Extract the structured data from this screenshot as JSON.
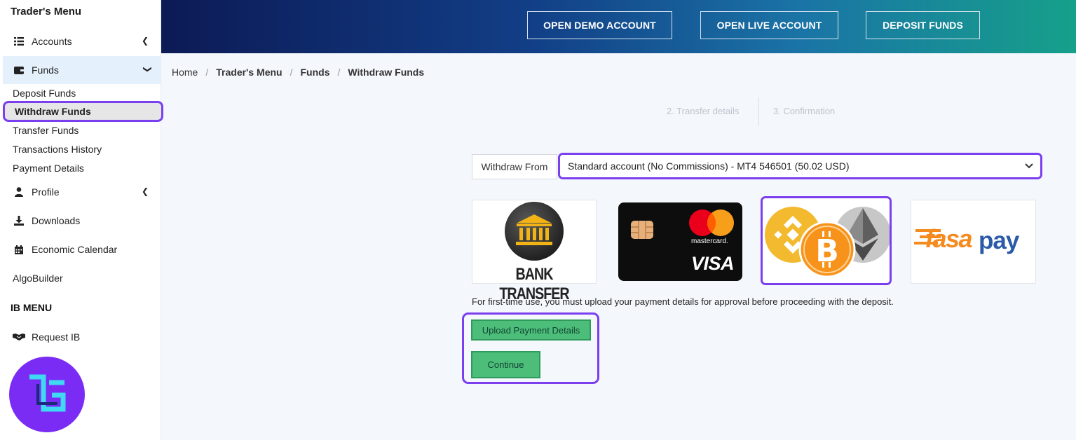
{
  "sidebar": {
    "title": "Trader's Menu",
    "accounts": {
      "label": "Accounts",
      "icon": "list-icon"
    },
    "funds": {
      "label": "Funds",
      "icon": "wallet-icon"
    },
    "funds_sub": [
      "Deposit Funds",
      "Withdraw Funds",
      "Transfer Funds",
      "Transactions History",
      "Payment Details"
    ],
    "profile": {
      "label": "Profile",
      "icon": "user-icon"
    },
    "downloads": {
      "label": "Downloads",
      "icon": "download-icon"
    },
    "calendar": {
      "label": "Economic Calendar",
      "icon": "calendar-icon"
    },
    "algobuilder": "AlgoBuilder",
    "ib_menu": "IB MENU",
    "request_ib": {
      "label": "Request IB",
      "icon": "handshake-icon"
    }
  },
  "header": {
    "open_demo": "OPEN DEMO ACCOUNT",
    "open_live": "OPEN LIVE ACCOUNT",
    "deposit": "DEPOSIT FUNDS"
  },
  "breadcrumb": {
    "home": "Home",
    "traders_menu": "Trader's Menu",
    "funds": "Funds",
    "current": "Withdraw Funds"
  },
  "steps": {
    "step2": "2. Transfer details",
    "step3": "3. Confirmation"
  },
  "withdraw": {
    "label": "Withdraw From",
    "selected_account": "Standard account (No Commissions) - MT4 546501 (50.02 USD)"
  },
  "methods": {
    "bank_label": "BANK TRANSFER",
    "card_brand_1": "mastercard.",
    "card_brand_2": "VISA",
    "fasapay_1": "fasa",
    "fasapay_2": "pay"
  },
  "note": "For first-time use, you must upload your payment details for approval before proceeding with the deposit.",
  "actions": {
    "upload": "Upload Payment Details",
    "continue": "Continue"
  },
  "colors": {
    "highlight": "#7b3ff0",
    "green_button": "#4dbe7a",
    "active_nav": "#e4f0fc"
  }
}
